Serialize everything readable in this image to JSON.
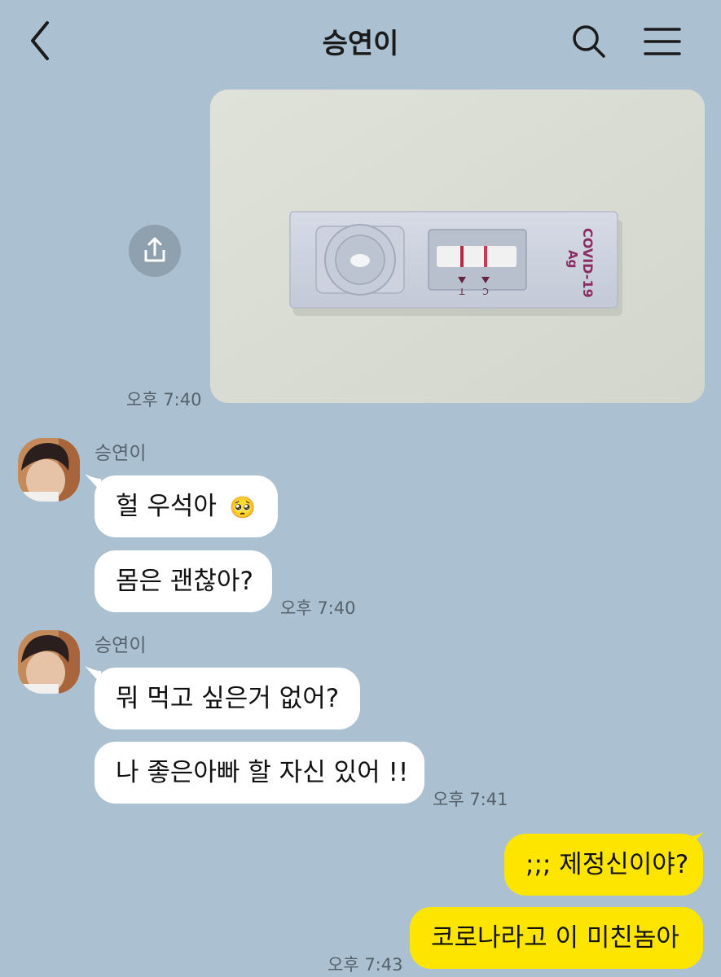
{
  "header": {
    "title": "승연이",
    "back_icon": "chevron-left-icon",
    "search_icon": "search-icon",
    "menu_icon": "hamburger-menu-icon"
  },
  "photo_message": {
    "test_label_1": "COVID-19",
    "test_label_2": "Ag",
    "mark_t": "T",
    "mark_c": "C",
    "time": "오후 7:40",
    "share_icon": "share-icon"
  },
  "groups": [
    {
      "sender": "승연이",
      "messages": [
        "헐 우석아",
        "몸은 괜찮아?"
      ],
      "emoji": "🥺",
      "time": "오후 7:40"
    },
    {
      "sender": "승연이",
      "messages": [
        "뭐 먹고 싶은거 없어?",
        "나 좋은아빠 할 자신 있어 !!"
      ],
      "time": "오후 7:41"
    }
  ],
  "my_messages": {
    "messages": [
      ";;; 제정신이야?",
      "코로나라고 이 미친놈아"
    ],
    "time": "오후 7:43"
  },
  "colors": {
    "background": "#abc1d1",
    "sent_bubble": "#fee500",
    "received_bubble": "#ffffff"
  }
}
